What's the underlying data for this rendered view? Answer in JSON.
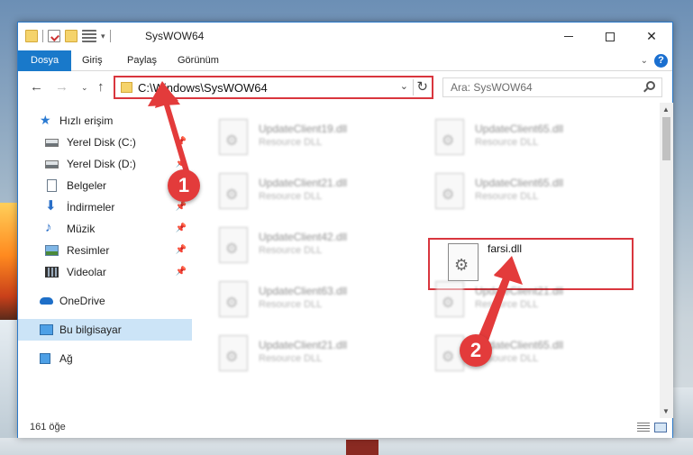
{
  "window": {
    "title": "SysWOW64",
    "minimize_label": "—",
    "close_label": "✕"
  },
  "ribbon": {
    "tabs": [
      "Dosya",
      "Giriş",
      "Paylaş",
      "Görünüm"
    ],
    "expand_label": "⌄",
    "help_label": "?"
  },
  "nav": {
    "back_label": "←",
    "forward_label": "→",
    "recent_label": "⌄",
    "up_label": "↑",
    "address": "C:\\Windows\\SysWOW64",
    "address_dropdown": "⌄",
    "refresh_label": "↻",
    "search_placeholder": "Ara: SysWOW64"
  },
  "sidebar": {
    "items": [
      {
        "label": "Hızlı erişim",
        "icon": "star-icon"
      },
      {
        "label": "Yerel Disk (C:)",
        "icon": "disk-icon",
        "pinned": true
      },
      {
        "label": "Yerel Disk (D:)",
        "icon": "disk-icon",
        "pinned": true
      },
      {
        "label": "Belgeler",
        "icon": "document-icon",
        "pinned": true
      },
      {
        "label": "İndirmeler",
        "icon": "download-icon",
        "pinned": true
      },
      {
        "label": "Müzik",
        "icon": "music-icon",
        "pinned": true
      },
      {
        "label": "Resimler",
        "icon": "pictures-icon",
        "pinned": true
      },
      {
        "label": "Videolar",
        "icon": "video-icon",
        "pinned": true
      },
      {
        "label": "OneDrive",
        "icon": "cloud-icon"
      },
      {
        "label": "Bu bilgisayar",
        "icon": "computer-icon",
        "selected": true
      },
      {
        "label": "Ağ",
        "icon": "network-icon"
      }
    ],
    "pin_glyph": "📌"
  },
  "files": [
    {
      "name": "UpdateClient19.dll",
      "type": "Resource DLL"
    },
    {
      "name": "UpdateClient65.dll",
      "type": "Resource DLL"
    },
    {
      "name": "UpdateClient21.dll",
      "type": "Resource DLL"
    },
    {
      "name": "UpdateClient65.dll",
      "type": "Resource DLL"
    },
    {
      "name": "UpdateClient42.dll",
      "type": "Resource DLL"
    },
    {
      "name": "farsi.dll",
      "type": ""
    },
    {
      "name": "UpdateClient63.dll",
      "type": "Resource DLL"
    },
    {
      "name": "UpdateClient21.dll",
      "type": "Resource DLL"
    },
    {
      "name": "UpdateClient21.dll",
      "type": "Resource DLL"
    },
    {
      "name": "UpdateClient65.dll",
      "type": "Resource DLL"
    }
  ],
  "status": {
    "count": "161 öğe"
  },
  "annotations": {
    "badge1": "1",
    "badge2": "2",
    "color": "#e33b3b"
  },
  "colors": {
    "accent": "#1979ca",
    "highlight": "#d9363e",
    "selected_bg": "#cce4f7"
  }
}
